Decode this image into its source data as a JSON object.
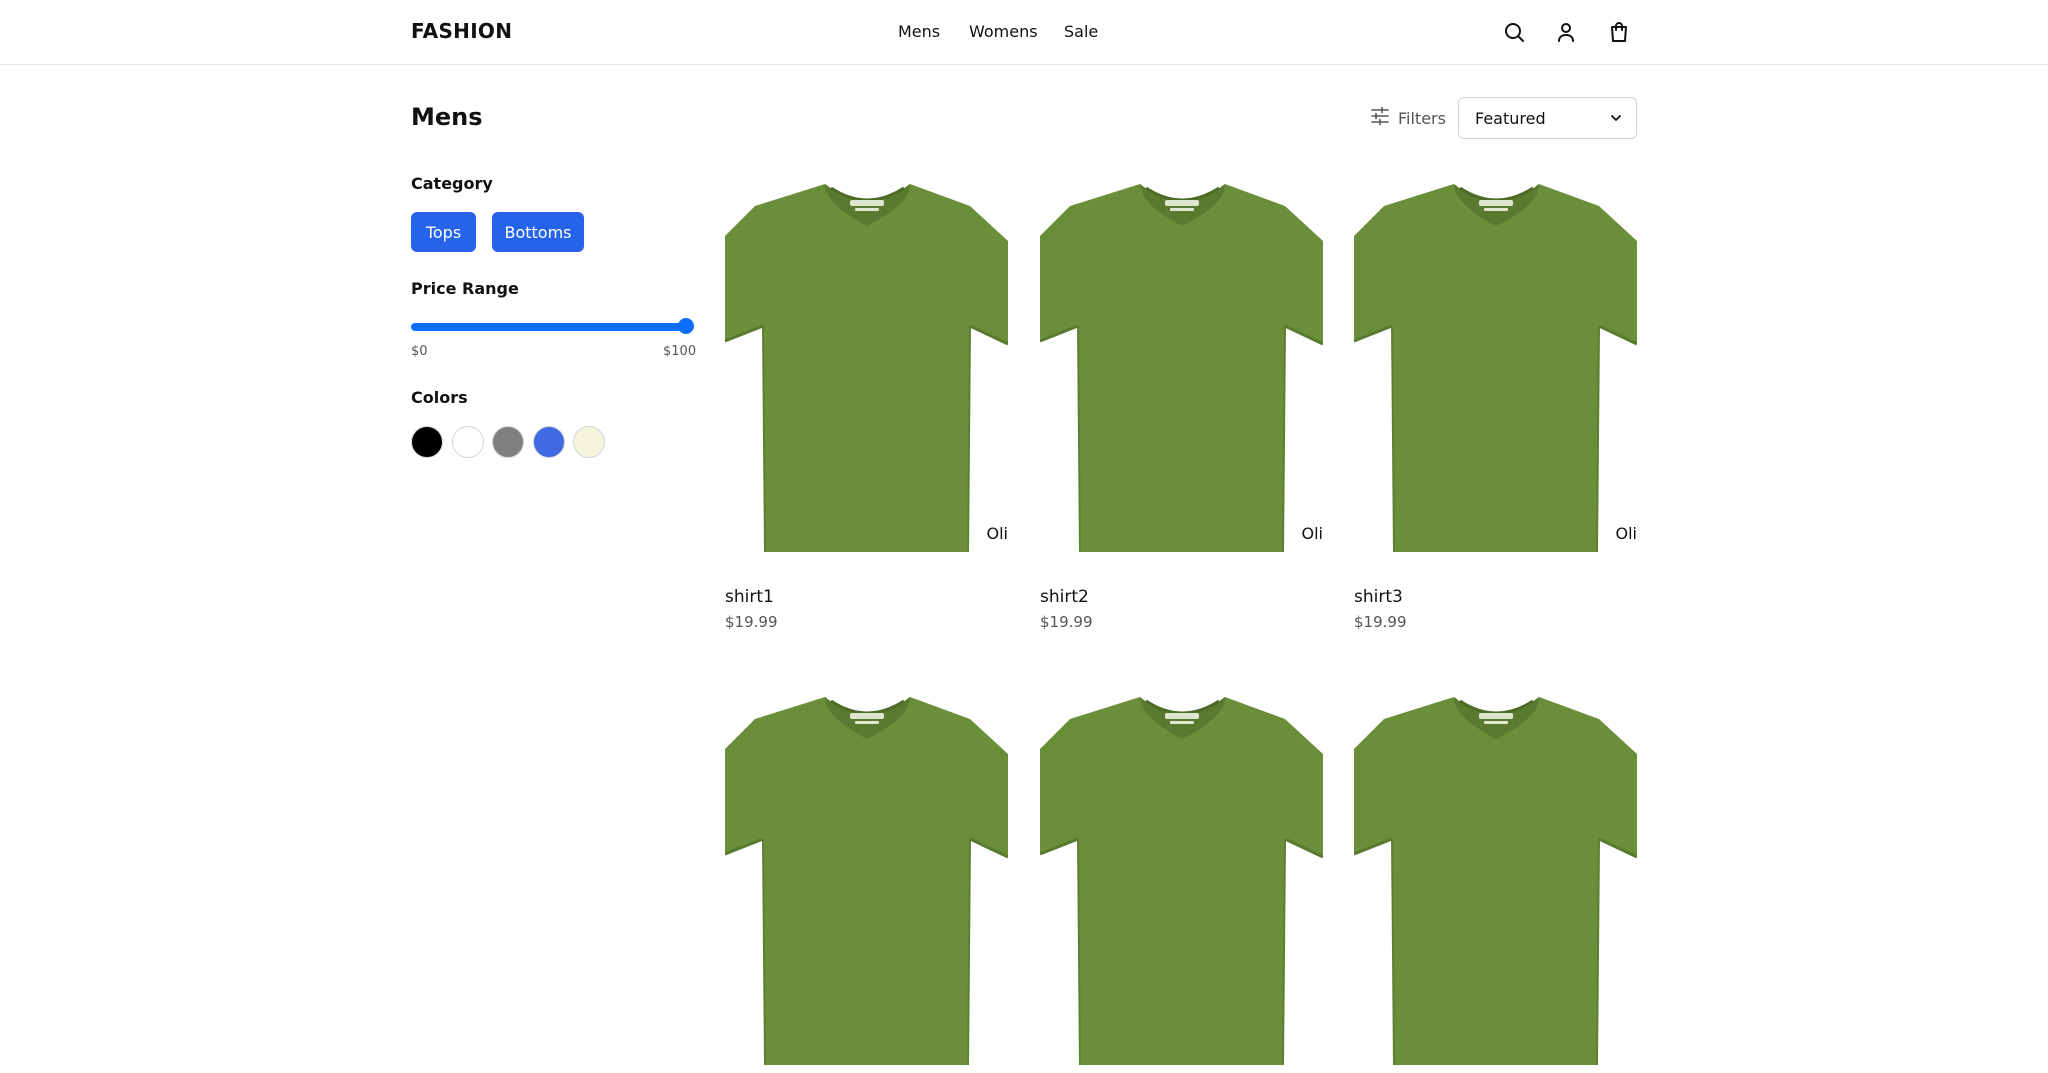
{
  "header": {
    "logo": "FASHION",
    "nav": [
      "Mens",
      "Womens",
      "Sale"
    ],
    "icons": [
      "search-icon",
      "user-icon",
      "shopping-bag-icon"
    ]
  },
  "page": {
    "title": "Mens"
  },
  "toolbar": {
    "filters_label": "Filters",
    "sort_value": "Featured"
  },
  "filters": {
    "category_label": "Category",
    "categories": [
      "Tops",
      "Bottoms"
    ],
    "price_label": "Price Range",
    "price_min": "$0",
    "price_max": "$100",
    "price_slider_value": 100,
    "colors_label": "Colors",
    "colors": [
      "#000000",
      "#ffffff",
      "#808080",
      "#4169e1",
      "#f5f5dc"
    ]
  },
  "products": [
    {
      "name": "shirt1",
      "price": "$19.99",
      "badge": "Oli"
    },
    {
      "name": "shirt2",
      "price": "$19.99",
      "badge": "Oli"
    },
    {
      "name": "shirt3",
      "price": "$19.99",
      "badge": "Oli"
    },
    {
      "name": "",
      "price": "",
      "badge": ""
    },
    {
      "name": "",
      "price": "",
      "badge": ""
    },
    {
      "name": "",
      "price": "",
      "badge": ""
    }
  ],
  "theme": {
    "accent": "#2563eb",
    "slider": "#0d6efd",
    "shirt": "#6b8e3a"
  }
}
